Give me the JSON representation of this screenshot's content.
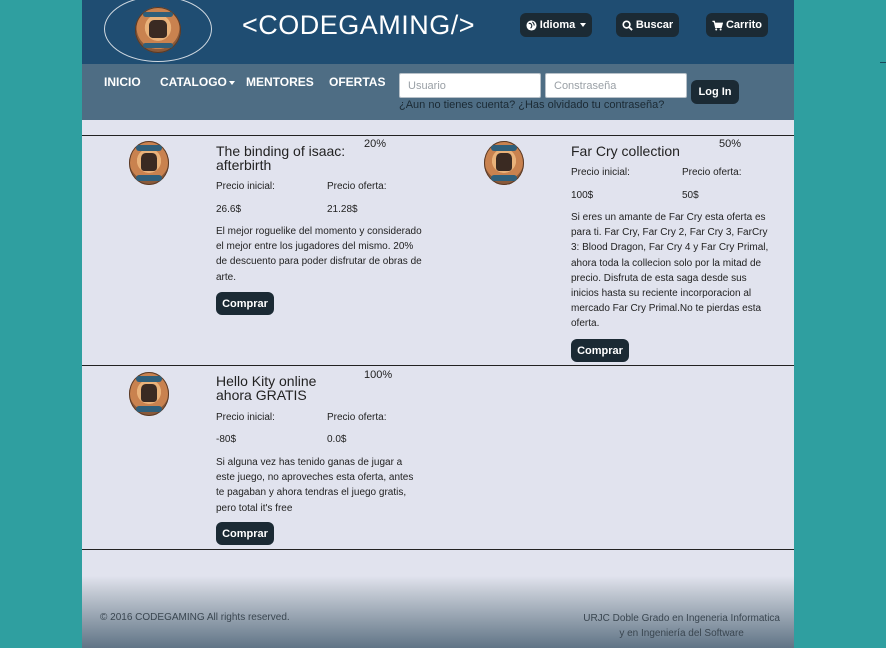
{
  "header": {
    "title": "<CODEGAMING/>",
    "buttons": {
      "language": "Idioma",
      "search": "Buscar",
      "cart": "Carrito"
    }
  },
  "nav": {
    "items": [
      {
        "label": "INICIO"
      },
      {
        "label": "CATALOGO"
      },
      {
        "label": "MENTORES"
      },
      {
        "label": "OFERTAS"
      }
    ],
    "login": {
      "username_placeholder": "Usuario",
      "password_placeholder": "Constraseña",
      "button": "Log In",
      "links_text": "¿Aun no tienes cuenta? ¿Has olvidado tu contraseña?"
    }
  },
  "offers": [
    {
      "title": "The binding of isaac: afterbirth",
      "discount": "20%",
      "initial_label": "Precio inicial:",
      "offer_label": "Precio oferta:",
      "initial_price": "26.6$",
      "offer_price": "21.28$",
      "description": "El mejor roguelike del momento y considerado el mejor entre los jugadores del mismo. 20% de descuento para poder disfrutar de obras de arte.",
      "buy": "Comprar"
    },
    {
      "title": "Far Cry collection",
      "discount": "50%",
      "initial_label": "Precio inicial:",
      "offer_label": "Precio oferta:",
      "initial_price": "100$",
      "offer_price": "50$",
      "description": "Si eres un amante de Far Cry esta oferta es para ti. Far Cry, Far Cry 2, Far Cry 3, FarCry 3: Blood Dragon, Far Cry 4 y Far Cry Primal, ahora toda la collecion solo por la mitad de precio. Disfruta de esta saga desde sus inicios hasta su reciente incorporacion al mercado Far Cry Primal.No te pierdas esta oferta.",
      "buy": "Comprar"
    },
    {
      "title": "Hello Kity online ahora GRATIS",
      "discount": "100%",
      "initial_label": "Precio inicial:",
      "offer_label": "Precio oferta:",
      "initial_price": "-80$",
      "offer_price": "0.0$",
      "description": "Si alguna vez has tenido ganas de jugar a este juego, no aproveches esta oferta, antes te pagaban y ahora tendras el juego gratis, pero total it's free",
      "buy": "Comprar"
    }
  ],
  "footer": {
    "copyright": "© 2016 CODEGAMING All rights reserved.",
    "credit_line1": "URJC Doble Grado en Ingeneria Informatica",
    "credit_line2": "y en Ingeniería del Software"
  }
}
